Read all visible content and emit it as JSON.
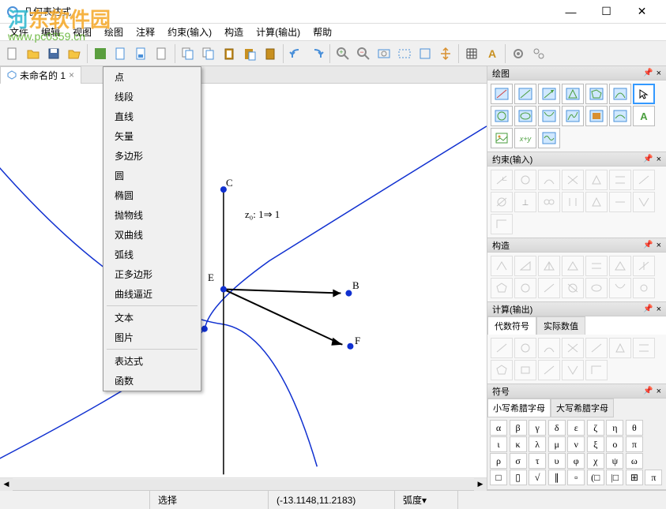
{
  "window": {
    "title": "几何表达式",
    "min": "—",
    "max": "☐",
    "close": "✕"
  },
  "menu": {
    "file": "文件",
    "edit": "编辑",
    "view": "视图",
    "draw": "绘图",
    "annotate": "注释",
    "constrain": "约束(输入)",
    "construct": "构造",
    "calculate": "计算(输出)",
    "help": "帮助"
  },
  "watermark": {
    "brand_left": "河",
    "brand_right": "东软件园",
    "url": "www.pc0359.cn"
  },
  "dropdown": {
    "items": [
      "点",
      "线段",
      "直线",
      "矢量",
      "多边形",
      "圆",
      "椭圆",
      "抛物线",
      "双曲线",
      "弧线",
      "正多边形",
      "曲线逼近"
    ],
    "sep1": true,
    "items2": [
      "文本",
      "图片"
    ],
    "sep2": true,
    "items3": [
      "表达式",
      "函数"
    ]
  },
  "tab": {
    "name": "未命名的 1",
    "close": "×"
  },
  "canvas": {
    "point_c": "C",
    "point_b": "B",
    "point_f": "F",
    "point_e": "E",
    "expr": "z₀: 1⇒ 1"
  },
  "panels": {
    "draw": "绘图",
    "constrain": "约束(输入)",
    "construct": "构造",
    "calculate": "计算(输出)",
    "symbols": "符号",
    "calc_tab1": "代数符号",
    "calc_tab2": "实际数值",
    "sym_tab1": "小写希腊字母",
    "sym_tab2": "大写希腊字母"
  },
  "symbols": {
    "row1": [
      "α",
      "β",
      "γ",
      "δ",
      "ε",
      "ζ",
      "η",
      "θ"
    ],
    "row2": [
      "ι",
      "κ",
      "λ",
      "μ",
      "ν",
      "ξ",
      "ο",
      "π"
    ],
    "row3": [
      "ρ",
      "σ",
      "τ",
      "υ",
      "φ",
      "χ",
      "ψ",
      "ω"
    ],
    "row4": [
      "□",
      "▯",
      "√",
      "∥",
      "▫",
      "(□",
      "|□",
      "⊞",
      "π"
    ]
  },
  "status": {
    "mode": "选择",
    "coords": "(-13.1148,11.2183)",
    "angle": "弧度"
  }
}
